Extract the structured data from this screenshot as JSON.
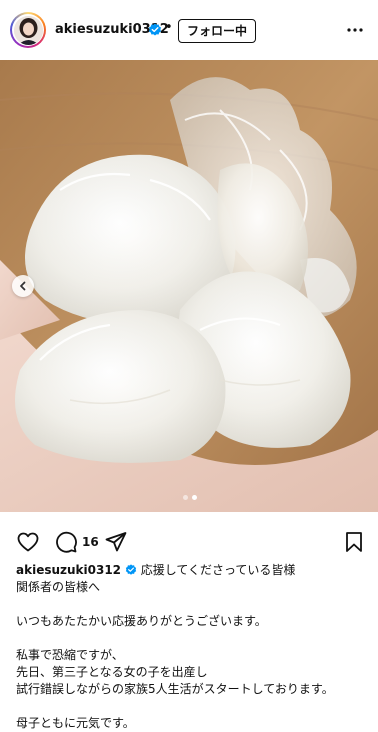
{
  "post": {
    "username": "akiesuzuki0312",
    "separator": "•",
    "follow_label": "フォロー中",
    "comment_count": "16",
    "caption_username": "akiesuzuki0312",
    "caption_lines": [
      "応援してくださっている皆様",
      "関係者の皆様へ",
      "いつもあたたかい応援ありがとうございます。",
      "私事で恐縮ですが、",
      "先日、第三子となる女の子を出産し",
      "試行錯誤しながらの家族5人生活がスタートしております。",
      "母子ともに元気です。"
    ]
  },
  "icons": {
    "verified": "verified-badge-icon",
    "more": "more-options-icon",
    "like": "heart-icon",
    "comment": "comment-icon",
    "share": "paper-plane-icon",
    "save": "bookmark-icon",
    "prev": "chevron-left-icon"
  },
  "colors": {
    "verified_blue": "#0095f6",
    "text": "#111111"
  }
}
